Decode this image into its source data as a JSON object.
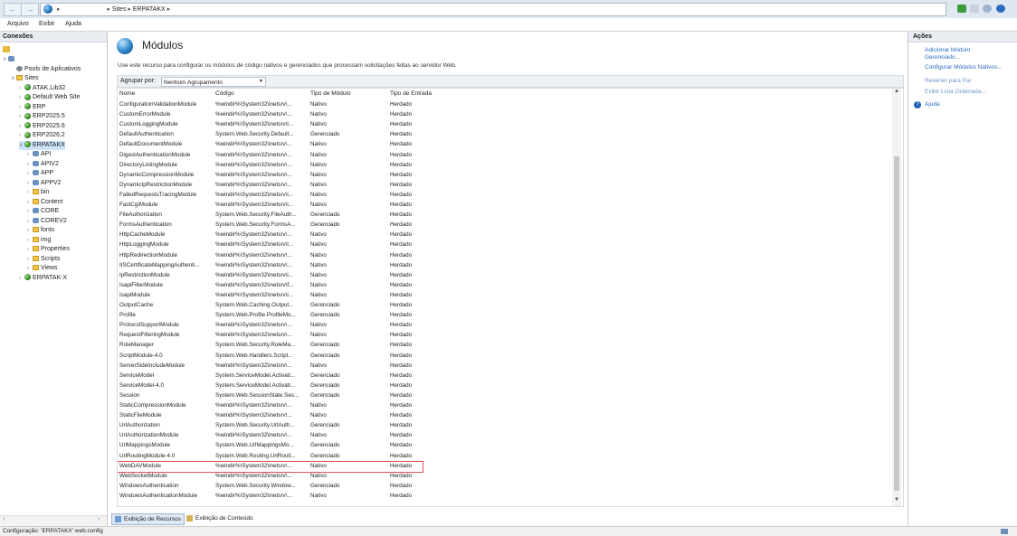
{
  "address_bar": {
    "crumbs": [
      "Sites",
      "ERPATAKX"
    ]
  },
  "menu": [
    "Arquivo",
    "Exibir",
    "Ajuda"
  ],
  "connections": {
    "header": "Conexões",
    "tree": [
      {
        "label": "",
        "icon": "server-icon",
        "indent": 1,
        "expanded": true
      },
      {
        "label": "Pools de Aplicativos",
        "icon": "app-pool-icon",
        "indent": 2
      },
      {
        "label": "Sites",
        "icon": "folder-icon",
        "indent": 2,
        "expanded": true
      },
      {
        "label": "ATAK.Lib32",
        "icon": "site-icon",
        "indent": 3
      },
      {
        "label": "Default Web Site",
        "icon": "site-icon",
        "indent": 3
      },
      {
        "label": "ERP",
        "icon": "site-icon",
        "indent": 3
      },
      {
        "label": "ERP2025.5",
        "icon": "site-icon",
        "indent": 3
      },
      {
        "label": "ERP2025.6",
        "icon": "site-icon",
        "indent": 3
      },
      {
        "label": "ERP2026.2",
        "icon": "site-icon",
        "indent": 3
      },
      {
        "label": "ERPATAKX",
        "icon": "site-icon",
        "indent": 3,
        "selected": true,
        "expanded": true
      },
      {
        "label": "API",
        "icon": "application-icon",
        "indent": 4
      },
      {
        "label": "APIV2",
        "icon": "application-icon",
        "indent": 4
      },
      {
        "label": "APP",
        "icon": "application-icon",
        "indent": 4
      },
      {
        "label": "APPV2",
        "icon": "application-icon",
        "indent": 4
      },
      {
        "label": "bin",
        "icon": "folder-icon",
        "indent": 4
      },
      {
        "label": "Content",
        "icon": "folder-icon",
        "indent": 4
      },
      {
        "label": "CORE",
        "icon": "application-icon",
        "indent": 4
      },
      {
        "label": "COREV2",
        "icon": "application-icon",
        "indent": 4
      },
      {
        "label": "fonts",
        "icon": "folder-icon",
        "indent": 4
      },
      {
        "label": "img",
        "icon": "folder-icon",
        "indent": 4
      },
      {
        "label": "Properties",
        "icon": "folder-icon",
        "indent": 4
      },
      {
        "label": "Scripts",
        "icon": "folder-icon",
        "indent": 4
      },
      {
        "label": "Views",
        "icon": "folder-icon",
        "indent": 4
      },
      {
        "label": "ERPATAK-X",
        "icon": "site-icon",
        "indent": 3
      }
    ]
  },
  "main": {
    "title": "Módulos",
    "description": "Use este recurso para configurar os módulos de código nativos e gerenciados que processam solicitações feitas ao servidor Web.",
    "group_label": "Agrupar por:",
    "group_value": "Nenhum Agrupamento",
    "columns": [
      "Nome",
      "Código",
      "Tipo de Módulo",
      "Tipo de Entrada"
    ],
    "rows": [
      [
        "ConfigurationValidationModule",
        "%windir%\\System32\\inetsrv\\...",
        "Nativo",
        "Herdado"
      ],
      [
        "CustomErrorModule",
        "%windir%\\System32\\inetsrv\\...",
        "Nativo",
        "Herdado"
      ],
      [
        "CustomLoggingModule",
        "%windir%\\System32\\inetsrv\\l...",
        "Nativo",
        "Herdado"
      ],
      [
        "DefaultAuthentication",
        "System.Web.Security.Default...",
        "Gerenciado",
        "Herdado"
      ],
      [
        "DefaultDocumentModule",
        "%windir%\\System32\\inetsrv\\...",
        "Nativo",
        "Herdado"
      ],
      [
        "DigestAuthenticationModule",
        "%windir%\\System32\\inetsrv\\...",
        "Nativo",
        "Herdado"
      ],
      [
        "DirectoryListingModule",
        "%windir%\\System32\\inetsrv\\...",
        "Nativo",
        "Herdado"
      ],
      [
        "DynamicCompressionModule",
        "%windir%\\System32\\inetsrv\\...",
        "Nativo",
        "Herdado"
      ],
      [
        "DynamicIpRestrictionModule",
        "%windir%\\System32\\inetsrv\\...",
        "Nativo",
        "Herdado"
      ],
      [
        "FailedRequestsTracingModule",
        "%windir%\\System32\\inetsrv\\i...",
        "Nativo",
        "Herdado"
      ],
      [
        "FastCgiModule",
        "%windir%\\System32\\inetsrv\\i...",
        "Nativo",
        "Herdado"
      ],
      [
        "FileAuthorization",
        "System.Web.Security.FileAuth...",
        "Gerenciado",
        "Herdado"
      ],
      [
        "FormsAuthentication",
        "System.Web.Security.FormsA...",
        "Gerenciado",
        "Herdado"
      ],
      [
        "HttpCacheModule",
        "%windir%\\System32\\inetsrv\\...",
        "Nativo",
        "Herdado"
      ],
      [
        "HttpLoggingModule",
        "%windir%\\System32\\inetsrv\\l...",
        "Nativo",
        "Herdado"
      ],
      [
        "HttpRedirectionModule",
        "%windir%\\System32\\inetsrv\\...",
        "Nativo",
        "Herdado"
      ],
      [
        "IISCertificateMappingAuthenti...",
        "%windir%\\System32\\inetsrv\\...",
        "Nativo",
        "Herdado"
      ],
      [
        "IpRestrictionModule",
        "%windir%\\System32\\inetsrv\\i...",
        "Nativo",
        "Herdado"
      ],
      [
        "IsapiFilterModule",
        "%windir%\\System32\\inetsrv\\f...",
        "Nativo",
        "Herdado"
      ],
      [
        "IsapiModule",
        "%windir%\\System32\\inetsrv\\i...",
        "Nativo",
        "Herdado"
      ],
      [
        "OutputCache",
        "System.Web.Caching.Output...",
        "Gerenciado",
        "Herdado"
      ],
      [
        "Profile",
        "System.Web.Profile.ProfileMo...",
        "Gerenciado",
        "Herdado"
      ],
      [
        "ProtocolSupportModule",
        "%windir%\\System32\\inetsrv\\...",
        "Nativo",
        "Herdado"
      ],
      [
        "RequestFilteringModule",
        "%windir%\\System32\\inetsrv\\...",
        "Nativo",
        "Herdado"
      ],
      [
        "RoleManager",
        "System.Web.Security.RoleMa...",
        "Gerenciado",
        "Herdado"
      ],
      [
        "ScriptModule-4.0",
        "System.Web.Handlers.Script...",
        "Gerenciado",
        "Herdado"
      ],
      [
        "ServerSideIncludeModule",
        "%windir%\\System32\\inetsrv\\...",
        "Nativo",
        "Herdado"
      ],
      [
        "ServiceModel",
        "System.ServiceModel.Activati...",
        "Gerenciado",
        "Herdado"
      ],
      [
        "ServiceModel-4.0",
        "System.ServiceModel.Activati...",
        "Gerenciado",
        "Herdado"
      ],
      [
        "Session",
        "System.Web.SessionState.Ses...",
        "Gerenciado",
        "Herdado"
      ],
      [
        "StaticCompressionModule",
        "%windir%\\System32\\inetsrv\\...",
        "Nativo",
        "Herdado"
      ],
      [
        "StaticFileModule",
        "%windir%\\System32\\inetsrv\\...",
        "Nativo",
        "Herdado"
      ],
      [
        "UrlAuthorization",
        "System.Web.Security.UrlAuth...",
        "Gerenciado",
        "Herdado"
      ],
      [
        "UrlAuthorizationModule",
        "%windir%\\System32\\inetsrv\\...",
        "Nativo",
        "Herdado"
      ],
      [
        "UrlMappingsModule",
        "System.Web.UrlMappingsMo...",
        "Gerenciado",
        "Herdado"
      ],
      [
        "UrlRoutingModule-4.0",
        "System.Web.Routing.UrlRouti...",
        "Gerenciado",
        "Herdado"
      ],
      [
        "WebDAVModule",
        "%windir%\\System32\\inetsrv\\...",
        "Nativo",
        "Herdado"
      ],
      [
        "WebSocketModule",
        "%windir%\\System32\\inetsrv\\...",
        "Nativo",
        "Herdado"
      ],
      [
        "WindowsAuthentication",
        "System.Web.Security.Window...",
        "Gerenciado",
        "Herdado"
      ],
      [
        "WindowsAuthenticationModule",
        "%windir%\\System32\\inetsrv\\...",
        "Nativo",
        "Herdado"
      ]
    ],
    "highlighted_row": "WebDAVModule",
    "tabs": [
      "Exibição de Recursos",
      "Exibição de Conteúdo"
    ]
  },
  "actions": {
    "header": "Ações",
    "items": [
      "Adicionar Módulo Gerenciado...",
      "Configurar Módulos Nativos...",
      "Reverter para Pai",
      "Exibir Lista Ordenada...",
      "Ajuda"
    ]
  },
  "status": "Configuração: 'ERPATAKX' web.config",
  "colors": {
    "accent": "#2a6bbf",
    "highlight_border": "#e05555",
    "selection": "#cde3f7"
  }
}
